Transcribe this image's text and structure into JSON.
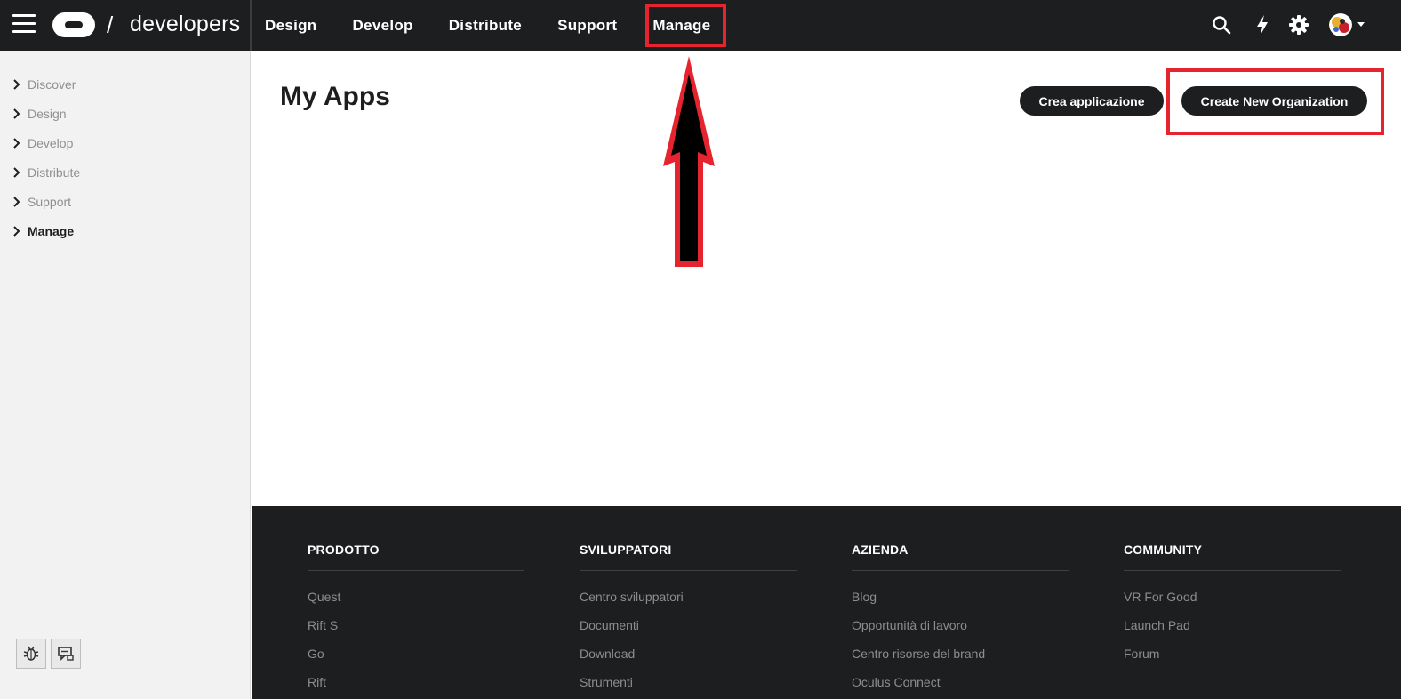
{
  "header": {
    "brand": "developers",
    "slash": "/",
    "nav": [
      "Design",
      "Develop",
      "Distribute",
      "Support",
      "Manage"
    ]
  },
  "sidebar": {
    "items": [
      {
        "label": "Discover",
        "active": false
      },
      {
        "label": "Design",
        "active": false
      },
      {
        "label": "Develop",
        "active": false
      },
      {
        "label": "Distribute",
        "active": false
      },
      {
        "label": "Support",
        "active": false
      },
      {
        "label": "Manage",
        "active": true
      }
    ],
    "tools": [
      "bug-icon",
      "feedback-icon"
    ]
  },
  "main": {
    "title": "My Apps",
    "create_app_label": "Crea applicazione",
    "create_org_label": "Create New Organization"
  },
  "footer": {
    "columns": [
      {
        "heading": "PRODOTTO",
        "links": [
          "Quest",
          "Rift S",
          "Go",
          "Rift"
        ]
      },
      {
        "heading": "SVILUPPATORI",
        "links": [
          "Centro sviluppatori",
          "Documenti",
          "Download",
          "Strumenti"
        ]
      },
      {
        "heading": "AZIENDA",
        "links": [
          "Blog",
          "Opportunità di lavoro",
          "Centro risorse del brand",
          "Oculus Connect"
        ]
      },
      {
        "heading": "COMMUNITY",
        "links": [
          "VR For Good",
          "Launch Pad",
          "Forum"
        ]
      }
    ]
  },
  "colors": {
    "dark": "#1c1e20",
    "highlight": "#e5242f",
    "sidebar_bg": "#f2f2f2"
  }
}
